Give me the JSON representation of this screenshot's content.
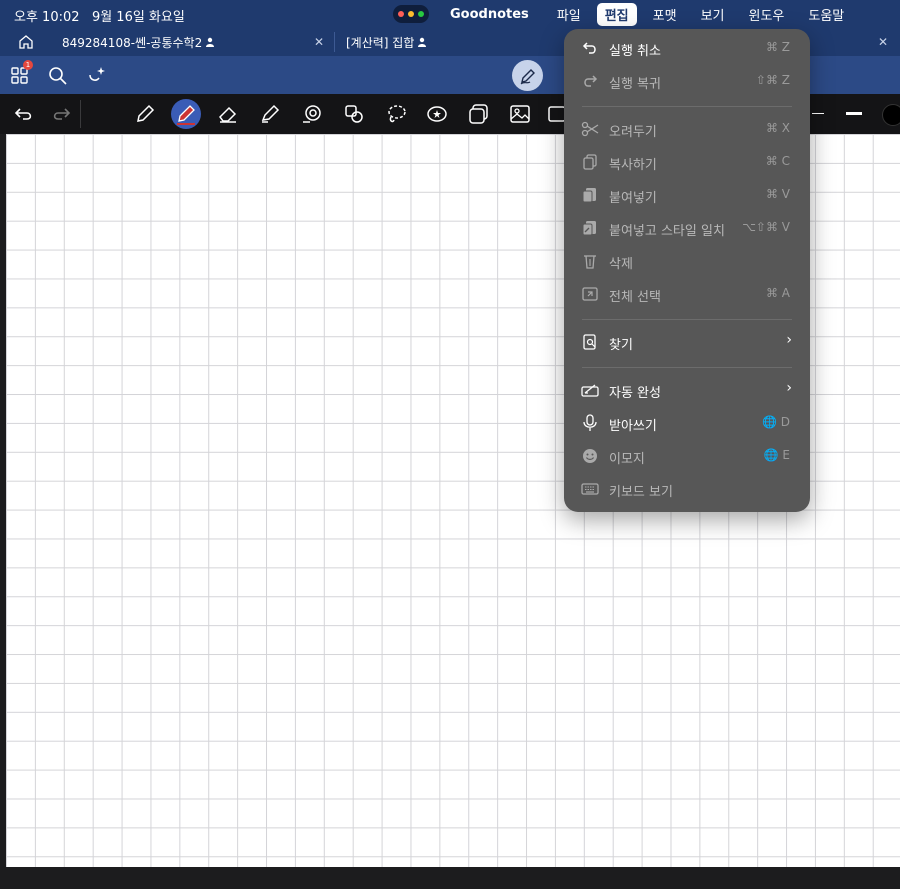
{
  "status": {
    "time": "오후 10:02",
    "date": "9월 16일 화요일"
  },
  "menubar": {
    "app": "Goodnotes",
    "items": [
      "파일",
      "편집",
      "포맷",
      "보기",
      "윈도우",
      "도움말"
    ]
  },
  "tabs": [
    {
      "label": "849284108-쎈-공통수학2"
    },
    {
      "label": "[계산력] 집합"
    }
  ],
  "toolbar": {
    "badge": "1"
  },
  "edit_menu": {
    "items": [
      {
        "label": "실행 취소",
        "shortcut": "⌘ Z"
      },
      {
        "label": "실행 복귀",
        "shortcut": "⇧⌘ Z"
      },
      {
        "label": "오려두기",
        "shortcut": "⌘ X"
      },
      {
        "label": "복사하기",
        "shortcut": "⌘ C"
      },
      {
        "label": "붙여넣기",
        "shortcut": "⌘ V"
      },
      {
        "label": "붙여넣고 스타일 일치",
        "shortcut": "⌥⇧⌘ V"
      },
      {
        "label": "삭제",
        "shortcut": ""
      },
      {
        "label": "전체 선택",
        "shortcut": "⌘ A"
      },
      {
        "label": "찾기",
        "shortcut": ""
      },
      {
        "label": "자동 완성",
        "shortcut": ""
      },
      {
        "label": "받아쓰기",
        "shortcut": "🌐 D"
      },
      {
        "label": "이모지",
        "shortcut": "🌐 E"
      },
      {
        "label": "키보드 보기",
        "shortcut": ""
      }
    ]
  }
}
